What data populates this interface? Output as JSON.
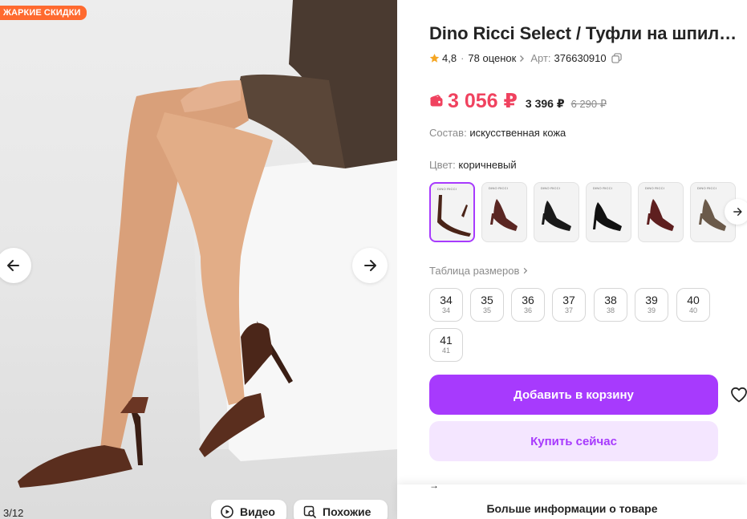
{
  "gallery": {
    "promo_badge": "ЖАРКИЕ СКИДКИ",
    "counter": "3/12",
    "video_label": "Видео",
    "similar_label": "Похожие"
  },
  "product": {
    "title": "Dino Ricci Select / Туфли на шпил…",
    "rating": "4,8",
    "reviews": "78 оценок",
    "article_label": "Арт:",
    "article": "376630910",
    "price_main": "3 056 ₽",
    "price_second": "3 396 ₽",
    "price_old": "6 290 ₽",
    "composition_label": "Состав:",
    "composition": "искусственная кожа",
    "color_label": "Цвет:",
    "color": "коричневый",
    "size_table_label": "Таблица размеров",
    "sizes": [
      {
        "size": "34",
        "sub": "34"
      },
      {
        "size": "35",
        "sub": "35"
      },
      {
        "size": "36",
        "sub": "36"
      },
      {
        "size": "37",
        "sub": "37"
      },
      {
        "size": "38",
        "sub": "38"
      },
      {
        "size": "39",
        "sub": "39"
      },
      {
        "size": "40",
        "sub": "40"
      },
      {
        "size": "41",
        "sub": "41"
      }
    ],
    "add_to_cart": "Добавить в корзину",
    "buy_now": "Купить сейчас",
    "more_info": "Больше информации о товаре",
    "swatch_brand": "DINO RICCI"
  },
  "colors": {
    "accent": "#a73afd",
    "accent_light": "#f4e6ff",
    "price": "#f0425f",
    "promo": "#ff6a2f",
    "star": "#f5a623"
  }
}
